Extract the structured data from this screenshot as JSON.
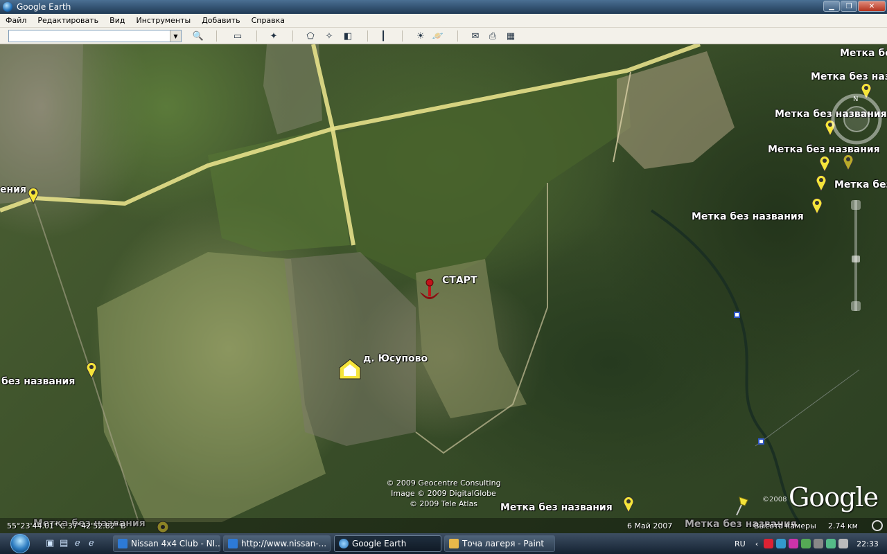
{
  "window": {
    "title": "Google Earth",
    "controls": {
      "minimize": "▁",
      "maximize": "❐",
      "close": "✕"
    }
  },
  "menu": [
    "Файл",
    "Редактировать",
    "Вид",
    "Инструменты",
    "Добавить",
    "Справка"
  ],
  "toolbar": {
    "search_value": "",
    "buttons": [
      "search-icon",
      "sidebar-icon",
      "placemark-icon",
      "polygon-icon",
      "path-icon",
      "overlay-icon",
      "ruler-icon",
      "sun-icon",
      "planets-icon",
      "email-icon",
      "print-icon",
      "maps-icon"
    ]
  },
  "map": {
    "labels": {
      "start": "СТАРТ",
      "village": "д. Юсупово",
      "left_top": "ения",
      "left_mid": "без названия",
      "bottom_left": "Метка без названия",
      "bottom_mid": "Метка без названия",
      "bottom_right": "Метка без названия",
      "tr_1": "Метка без",
      "tr_2": "Метка без названия",
      "tr_3": "Метка без названия",
      "tr_4": "Метка без названия",
      "tr_5": "Метка без",
      "tr_6": "Метка без названия"
    },
    "copyright": [
      "© 2009 Geocentre Consulting",
      "Image © 2009 DigitalGlobe",
      "© 2009 Tele Atlas"
    ],
    "logo": "Google",
    "logo_year": "©2008"
  },
  "status": {
    "coordinates": "55°23'44.01\" С    37°42'52.82\" В",
    "date": "6 Май 2007",
    "altitude_label": "Высота камеры",
    "altitude_value": "2.74 км"
  },
  "taskbar": {
    "tasks": [
      {
        "label": "Nissan 4x4 Club - NI...",
        "active": false
      },
      {
        "label": "http://www.nissan-...",
        "active": false
      },
      {
        "label": "Google Earth",
        "active": true
      },
      {
        "label": "Точа лагеря - Paint",
        "active": false
      }
    ],
    "language": "RU",
    "clock": "22:33"
  },
  "colors": {
    "road": "#e6e08a",
    "pin_yellow": "#f5e43a",
    "start_pin": "#c0141a"
  }
}
